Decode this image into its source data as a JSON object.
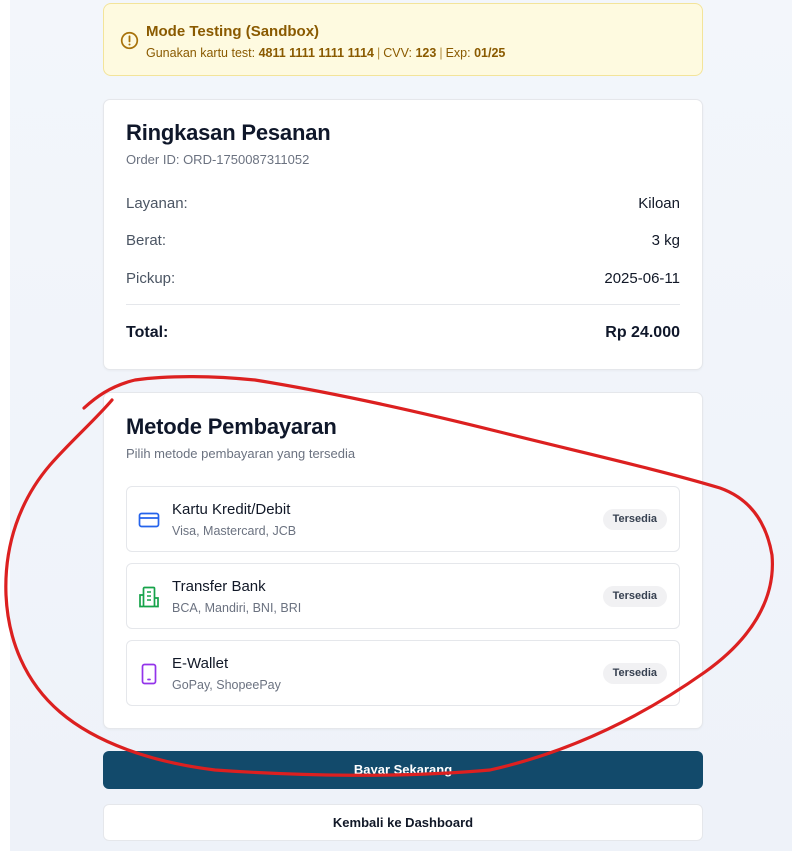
{
  "banner": {
    "title": "Mode Testing (Sandbox)",
    "card_prefix": "Gunakan kartu test: ",
    "card_number": "4811 1111 1111 1114",
    "separator": "|",
    "cvv_label": "CVV: ",
    "cvv_value": "123",
    "exp_label": "Exp: ",
    "exp_value": "01/25",
    "icon": "alert-circle-icon",
    "color": "#8a5a00"
  },
  "summary": {
    "title": "Ringkasan Pesanan",
    "order_id": "Order ID: ORD-1750087311052",
    "rows": [
      {
        "label": "Layanan:",
        "value": "Kiloan"
      },
      {
        "label": "Berat:",
        "value": "3 kg"
      },
      {
        "label": "Pickup:",
        "value": "2025-06-11"
      }
    ],
    "total_label": "Total:",
    "total_value": "Rp 24.000"
  },
  "payment": {
    "title": "Metode Pembayaran",
    "subtitle": "Pilih metode pembayaran yang tersedia",
    "methods": [
      {
        "title": "Kartu Kredit/Debit",
        "desc": "Visa, Mastercard, JCB",
        "badge": "Tersedia",
        "icon": "credit-card-icon",
        "color": "#2563eb"
      },
      {
        "title": "Transfer Bank",
        "desc": "BCA, Mandiri, BNI, BRI",
        "badge": "Tersedia",
        "icon": "bank-building-icon",
        "color": "#16a34a"
      },
      {
        "title": "E-Wallet",
        "desc": "GoPay, ShopeePay",
        "badge": "Tersedia",
        "icon": "smartphone-icon",
        "color": "#9333ea"
      }
    ]
  },
  "actions": {
    "pay_label": "Bayar Sekarang",
    "back_label": "Kembali ke Dashboard",
    "pay_color": "#124a6b"
  },
  "annotation": {
    "color": "#dc2020"
  }
}
